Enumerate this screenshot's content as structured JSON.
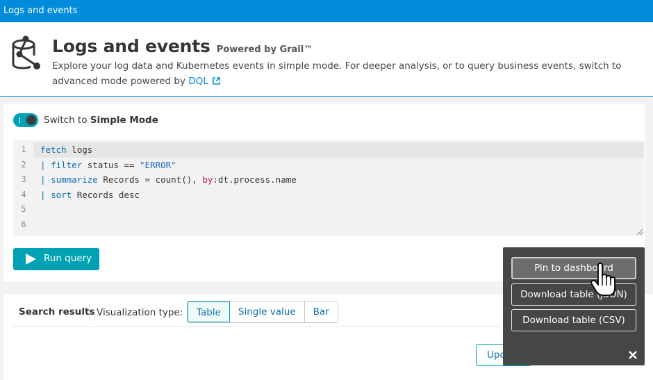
{
  "topbar": {
    "title": "Logs and events"
  },
  "header": {
    "title": "Logs and events",
    "powered_by": "Powered by Grail™",
    "description": "Explore your log data and Kubernetes events in simple mode. For deeper analysis, or to query business events, switch to advanced mode powered by",
    "dql_link": "DQL",
    "icon": "logs-events-app-icon"
  },
  "editor": {
    "toggle_prefix": "Switch to ",
    "toggle_mode": "Simple Mode",
    "toggle_on": true,
    "line_numbers": [
      "1",
      "2",
      "3",
      "4",
      "5",
      "6"
    ],
    "query_lines": [
      "fetch logs",
      "| filter status == \"ERROR\"",
      "| summarize Records = count(), by:dt.process.name",
      "| sort Records desc",
      "",
      ""
    ],
    "run_label": "Run query"
  },
  "results": {
    "heading": "Search results",
    "viz_label": "Visualization type:",
    "viz_options": [
      "Table",
      "Single value",
      "Bar"
    ],
    "viz_selected": "Table",
    "update_label": "Upd"
  },
  "popup": {
    "pin_label": "Pin to dashboard",
    "json_label": "Download table (JSON)",
    "csv_label": "Download table (CSV)"
  },
  "colors": {
    "brand_blue": "#008cdb",
    "accent_teal": "#00a1b2",
    "popup_bg": "#454646"
  }
}
